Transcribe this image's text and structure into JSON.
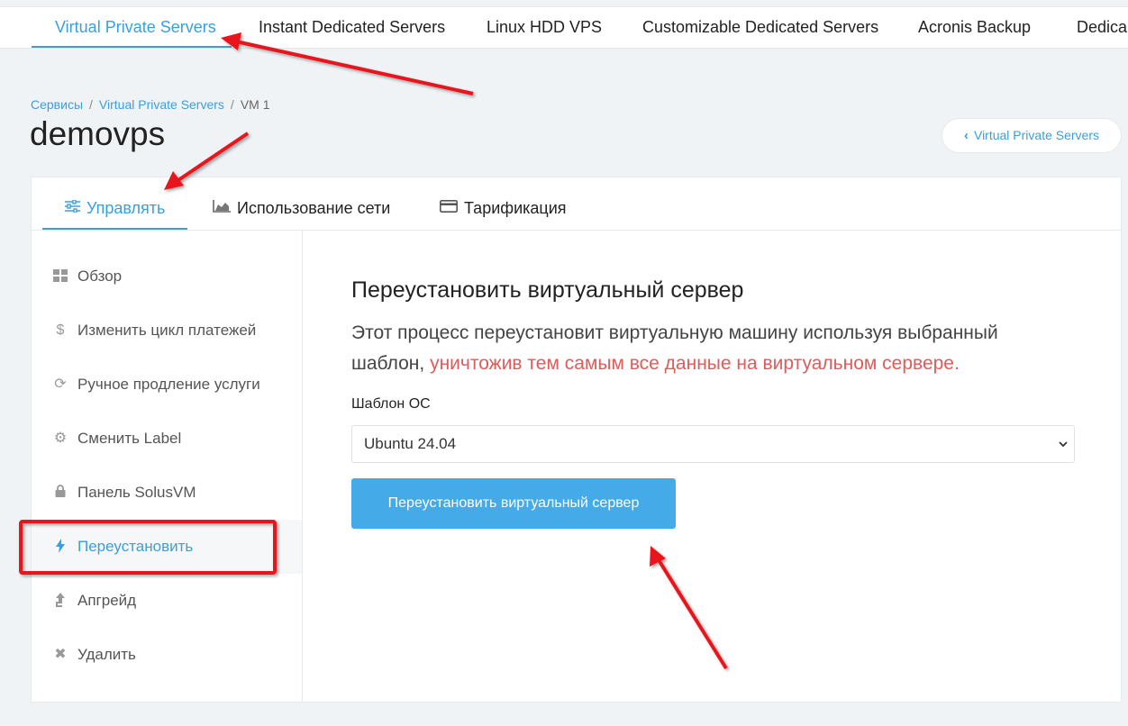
{
  "topnav": {
    "items": [
      {
        "label": "Virtual Private Servers",
        "active": true
      },
      {
        "label": "Instant Dedicated Servers"
      },
      {
        "label": "Linux HDD VPS"
      },
      {
        "label": "Customizable Dedicated Servers"
      },
      {
        "label": "Acronis Backup"
      },
      {
        "label": "Dedica"
      }
    ]
  },
  "breadcrumb": {
    "items": [
      "Сервисы",
      "Virtual Private Servers",
      "VM 1"
    ],
    "separator": "/"
  },
  "page": {
    "title": "demovps",
    "back_button": "Virtual Private Servers"
  },
  "tabs": [
    {
      "label": "Управлять",
      "icon": "sliders-icon",
      "active": true
    },
    {
      "label": "Использование сети",
      "icon": "area-chart-icon"
    },
    {
      "label": "Тарификация",
      "icon": "credit-card-icon"
    }
  ],
  "sidebar": {
    "items": [
      {
        "label": "Обзор",
        "icon": "grid-icon"
      },
      {
        "label": "Изменить цикл платежей",
        "icon": "dollar-icon"
      },
      {
        "label": "Ручное продление услуги",
        "icon": "refresh-icon"
      },
      {
        "label": "Сменить Label",
        "icon": "gear-icon"
      },
      {
        "label": "Панель SolusVM",
        "icon": "lock-icon"
      },
      {
        "label": "Переустановить",
        "icon": "bolt-icon",
        "active": true
      },
      {
        "label": "Апгрейд",
        "icon": "upgrade-arrow-icon"
      },
      {
        "label": "Удалить",
        "icon": "close-icon"
      }
    ]
  },
  "main": {
    "title": "Переустановить виртуальный сервер",
    "desc_normal": "Этот процесс переустановит виртуальную машину используя выбранный шаблон,",
    "desc_warning": "уничтожив тем самым все данные на виртуальном сервере.",
    "os_label": "Шаблон ОС",
    "os_selected": "Ubuntu 24.04",
    "submit_label": "Переустановить виртуальный сервер"
  },
  "colors": {
    "accent": "#3a9fdd",
    "button": "#44aae8",
    "warning": "#e25a5a",
    "annotation": "#e8191b"
  }
}
